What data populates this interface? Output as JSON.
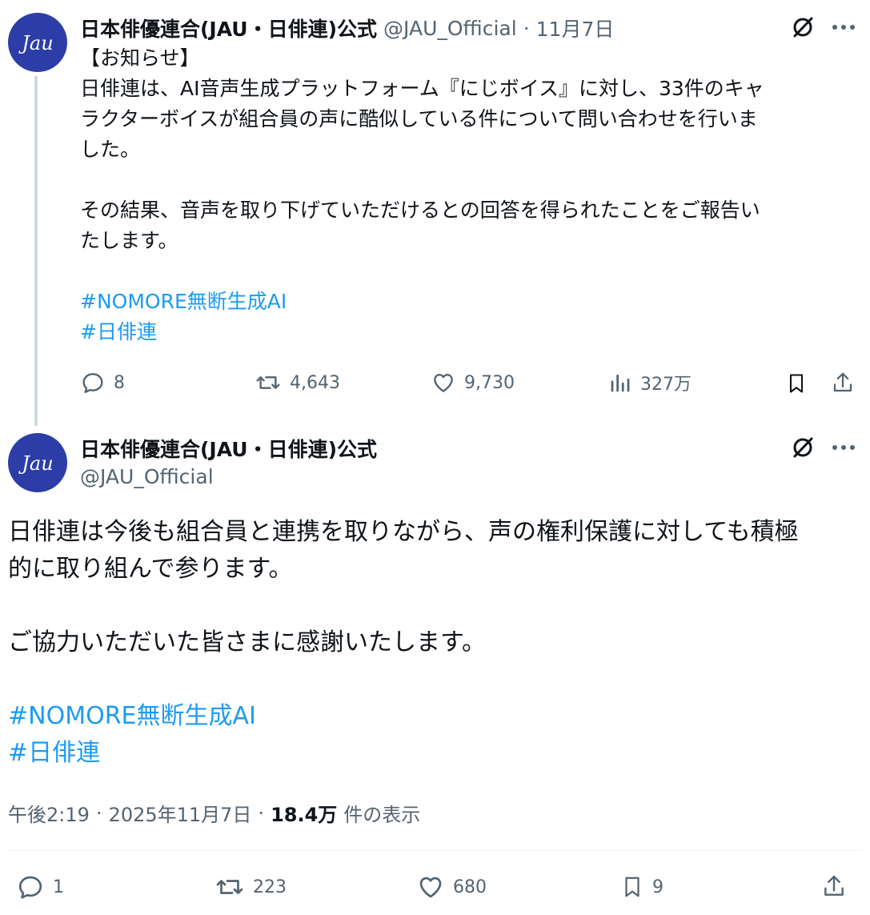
{
  "tweet1": {
    "author_name": "日本俳優連合(JAU・日俳連)公式",
    "handle": "@JAU_Official",
    "separator": "·",
    "date": "11月7日",
    "lines": [
      "【お知らせ】",
      "日俳連は、AI音声生成プラットフォーム『にじボイス』に対し、33件のキャ",
      "ラクターボイスが組合員の声に酷似している件について問い合わせを行いま",
      "した。",
      "その結果、音声を取り下げていただけるとの回答を得られたことをご報告い",
      "たします。"
    ],
    "hashtags": [
      "#NOMORE無断生成AI",
      "#日俳連"
    ],
    "replies": "8",
    "reposts": "4,643",
    "likes": "9,730",
    "views": "327万"
  },
  "tweet2": {
    "author_name": "日本俳優連合(JAU・日俳連)公式",
    "handle": "@JAU_Official",
    "lines": [
      "日俳連は今後も組合員と連携を取りながら、声の権利保護に対しても積極",
      "的に取り組んで参ります。",
      "ご協力いただいた皆さまに感謝いたします。"
    ],
    "hashtags": [
      "#NOMORE無断生成AI",
      "#日俳連"
    ],
    "time": "午後2:19",
    "dot": "·",
    "date": "2025年11月7日",
    "views_count": "18.4万",
    "views_label": "件の表示",
    "replies": "1",
    "reposts": "223",
    "likes": "680",
    "bookmarks": "9"
  },
  "avatar_text": "Jau",
  "icons": [
    "grok-icon",
    "more-icon",
    "reply-icon",
    "repost-icon",
    "like-icon",
    "views-icon",
    "bookmark-icon",
    "share-icon"
  ],
  "colors": {
    "link": "#1d9bf0",
    "secondary": "#536471",
    "avatar_bg": "#2c3da8"
  }
}
